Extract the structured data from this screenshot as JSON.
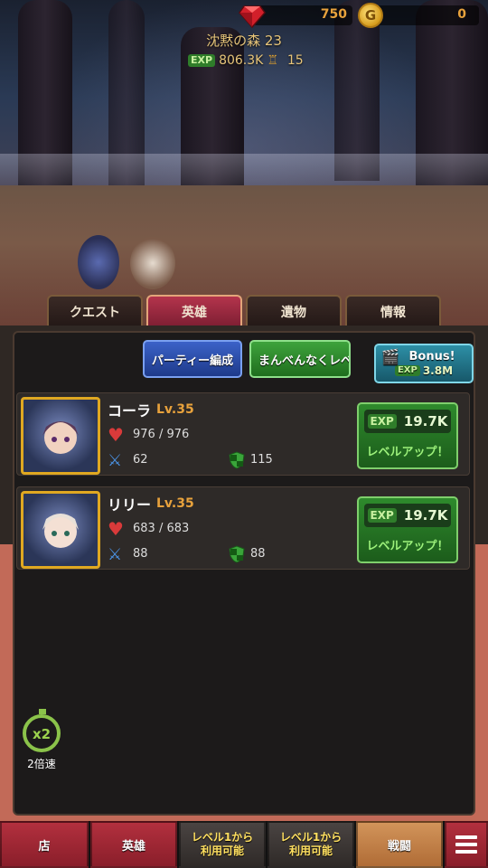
{
  "top": {
    "gems": "750",
    "coins": "0",
    "stage": "沈黙の森 23",
    "exp_label": "EXP",
    "exp_value": "806.3K",
    "trophies": "15"
  },
  "tabs": [
    {
      "label": "クエスト",
      "active": false
    },
    {
      "label": "英雄",
      "active": true
    },
    {
      "label": "遺物",
      "active": false
    },
    {
      "label": "情報",
      "active": false
    }
  ],
  "actions": {
    "party": "パーティー編成",
    "levelup_all": "まんべんなくレベルアップ！",
    "bonus_label": "Bonus!",
    "bonus_exp_label": "EXP",
    "bonus_exp_value": "3.8M"
  },
  "heroes": [
    {
      "name": "コーラ",
      "level": "Lv.35",
      "hp": "976 / 976",
      "attack": "62",
      "defense": "115",
      "cost_label": "EXP",
      "cost": "19.7K",
      "button": "レベルアップ！"
    },
    {
      "name": "リリー",
      "level": "Lv.35",
      "hp": "683 / 683",
      "attack": "88",
      "defense": "88",
      "cost_label": "EXP",
      "cost": "19.7K",
      "button": "レベルアップ！"
    }
  ],
  "speed": {
    "badge": "x2",
    "label": "2倍速"
  },
  "bottom_nav": {
    "shop": "店",
    "hero": "英雄",
    "locked1_line1": "レベル1から",
    "locked1_line2": "利用可能",
    "locked2_line1": "レベル1から",
    "locked2_line2": "利用可能",
    "battle": "戦闘"
  },
  "icons": {
    "gem": "gem-icon",
    "coin": "coin-icon",
    "trophy": "trophy-icon",
    "heart": "heart-icon",
    "sword": "sword-icon",
    "shield": "shield-icon",
    "clapperboard": "clapperboard-icon",
    "stopwatch": "stopwatch-icon",
    "menu": "hamburger-icon"
  },
  "colors": {
    "accent_gold": "#e8a23c",
    "tab_active": "#b4344c",
    "button_green": "#2e8a2c",
    "button_blue": "#3b62c8",
    "panel_bg": "#1c1a1a"
  }
}
